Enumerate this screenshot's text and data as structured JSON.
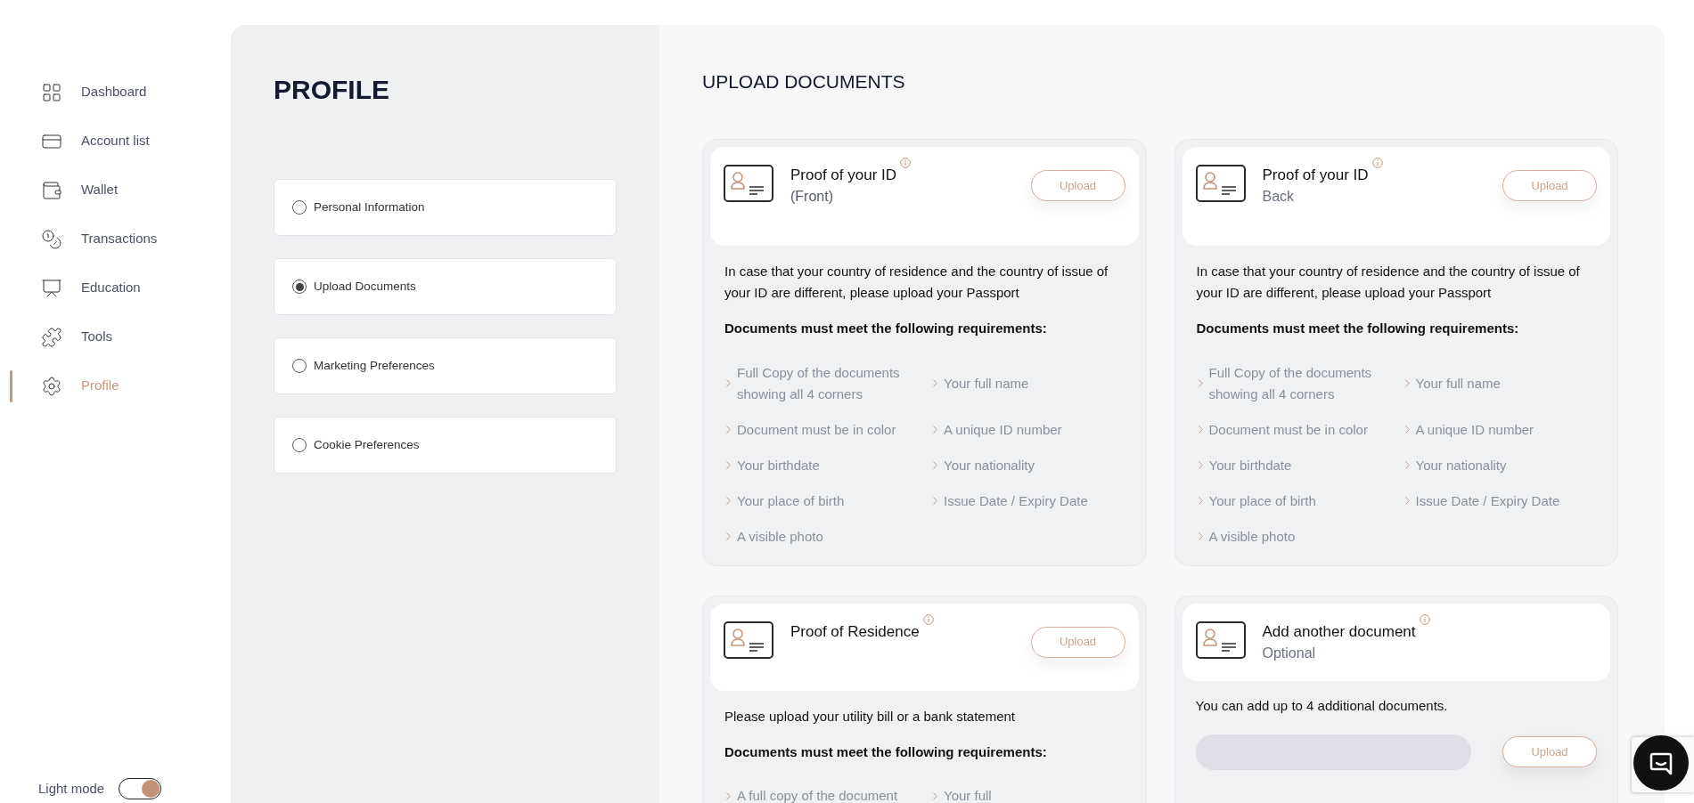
{
  "sidebar": {
    "items": [
      {
        "label": "Dashboard",
        "selected": false
      },
      {
        "label": "Account list",
        "selected": false
      },
      {
        "label": "Wallet",
        "selected": false
      },
      {
        "label": "Transactions",
        "selected": false
      },
      {
        "label": "Education",
        "selected": false
      },
      {
        "label": "Tools",
        "selected": false
      },
      {
        "label": "Profile",
        "selected": true
      }
    ],
    "light_mode": {
      "label": "Light mode",
      "on": true
    }
  },
  "profile": {
    "title": "PROFILE",
    "options": [
      {
        "label": "Personal Information",
        "selected": false
      },
      {
        "label": "Upload Documents",
        "selected": true
      },
      {
        "label": "Marketing Preferences",
        "selected": false
      },
      {
        "label": "Cookie Preferences",
        "selected": false
      }
    ]
  },
  "upload": {
    "title": "UPLOAD DOCUMENTS",
    "cards": [
      {
        "kind": "requirements",
        "title": "Proof of your ID",
        "subtitle": "(Front)",
        "button": "Upload",
        "description": "In case that your country of residence and the country of issue of your ID are different, please upload your Passport",
        "requirements_heading": "Documents must meet the following requirements:",
        "requirements": [
          "Full Copy of the documents showing all 4 corners",
          "Your full name",
          "Document must be in color",
          "A unique ID number",
          "Your birthdate",
          "Your nationality",
          "Your place of birth",
          "Issue Date / Expiry Date",
          "A visible photo"
        ]
      },
      {
        "kind": "requirements",
        "title": "Proof of your ID",
        "subtitle": "Back",
        "button": "Upload",
        "description": "In case that your country of residence and the country of issue of your ID are different, please upload your Passport",
        "requirements_heading": "Documents must meet the following requirements:",
        "requirements": [
          "Full Copy of the documents showing all 4 corners",
          "Your full name",
          "Document must be in color",
          "A unique ID number",
          "Your birthdate",
          "Your nationality",
          "Your place of birth",
          "Issue Date / Expiry Date",
          "A visible photo"
        ]
      },
      {
        "kind": "requirements",
        "title": "Proof of Residence",
        "button": "Upload",
        "description": "Please upload your utility bill or a bank statement",
        "requirements_heading": "Documents must meet the following requirements:",
        "requirements": [
          "A full copy of the document",
          "Your full"
        ]
      },
      {
        "kind": "additional",
        "title": "Add another document",
        "subtitle": "Optional",
        "button": "Upload",
        "description": "You can add up to 4 additional documents."
      }
    ]
  }
}
